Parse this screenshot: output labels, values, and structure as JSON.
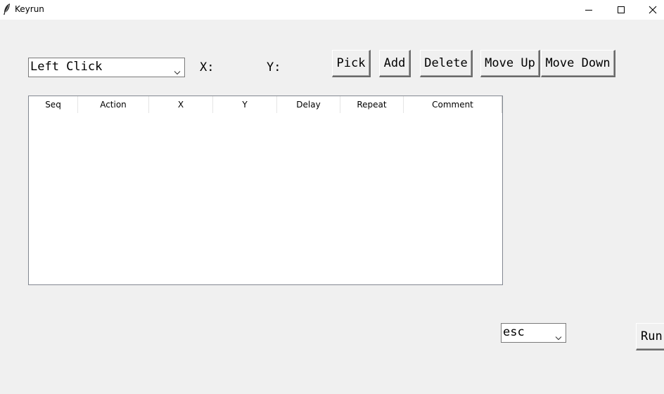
{
  "window": {
    "title": "Keyrun",
    "controls": [
      "minimize",
      "maximize",
      "close"
    ]
  },
  "toolbar": {
    "action_select": {
      "selected": "Left Click"
    },
    "x_label": "X:",
    "y_label": "Y:",
    "x_value": "",
    "y_value": "",
    "pick_label": "Pick",
    "add_label": "Add",
    "delete_label": "Delete",
    "move_up_label": "Move Up",
    "move_down_label": "Move Down"
  },
  "table": {
    "columns": [
      "Seq",
      "Action",
      "X",
      "Y",
      "Delay",
      "Repeat",
      "Comment"
    ],
    "rows": []
  },
  "footer": {
    "key_select": {
      "selected": "esc"
    },
    "run_label": "Run"
  }
}
